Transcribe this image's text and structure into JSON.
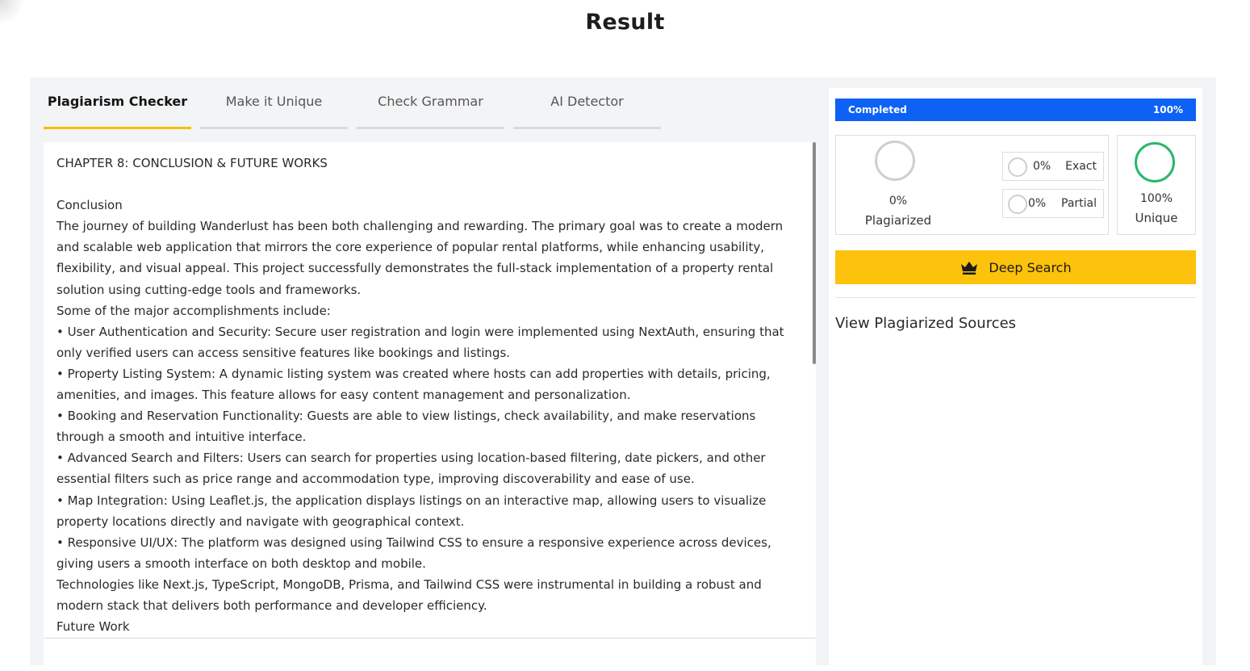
{
  "page": {
    "title": "Result"
  },
  "tabs": [
    {
      "label": "Plagiarism Checker",
      "active": true
    },
    {
      "label": "Make it Unique",
      "active": false
    },
    {
      "label": "Check Grammar",
      "active": false
    },
    {
      "label": "AI Detector",
      "active": false
    }
  ],
  "editor": {
    "text": "CHAPTER 8: CONCLUSION & FUTURE WORKS\n\nConclusion\nThe journey of building Wanderlust has been both challenging and rewarding. The primary goal was to create a modern and scalable web application that mirrors the core experience of popular rental platforms, while enhancing usability, flexibility, and visual appeal. This project successfully demonstrates the full-stack implementation of a property rental solution using cutting-edge tools and frameworks.\nSome of the major accomplishments include:\n• User Authentication and Security: Secure user registration and login were implemented using NextAuth, ensuring that only verified users can access sensitive features like bookings and listings.\n• Property Listing System: A dynamic listing system was created where hosts can add properties with details, pricing, amenities, and images. This feature allows for easy content management and personalization.\n• Booking and Reservation Functionality: Guests are able to view listings, check availability, and make reservations through a smooth and intuitive interface.\n• Advanced Search and Filters: Users can search for properties using location-based filtering, date pickers, and other essential filters such as price range and accommodation type, improving discoverability and ease of use.\n• Map Integration: Using Leaflet.js, the application displays listings on an interactive map, allowing users to visualize property locations directly and navigate with geographical context.\n• Responsive UI/UX: The platform was designed using Tailwind CSS to ensure a responsive experience across devices, giving users a smooth interface on both desktop and mobile.\nTechnologies like Next.js, TypeScript, MongoDB, Prisma, and Tailwind CSS were instrumental in building a robust and modern stack that delivers both performance and developer efficiency.\nFuture Work"
  },
  "progress": {
    "label": "Completed",
    "value_text": "100%",
    "value": 100,
    "color": "#0d62f5"
  },
  "stats": {
    "plagiarized": {
      "pct": "0%",
      "label": "Plagiarized"
    },
    "exact": {
      "pct": "0%",
      "label": "Exact"
    },
    "partial": {
      "pct": "0%",
      "label": "Partial"
    },
    "unique": {
      "pct": "100%",
      "label": "Unique",
      "color": "#28b86a"
    }
  },
  "deep_search": {
    "label": "Deep Search",
    "icon": "crown-icon",
    "color": "#fdc20b"
  },
  "sources": {
    "title": "View Plagiarized Sources"
  }
}
